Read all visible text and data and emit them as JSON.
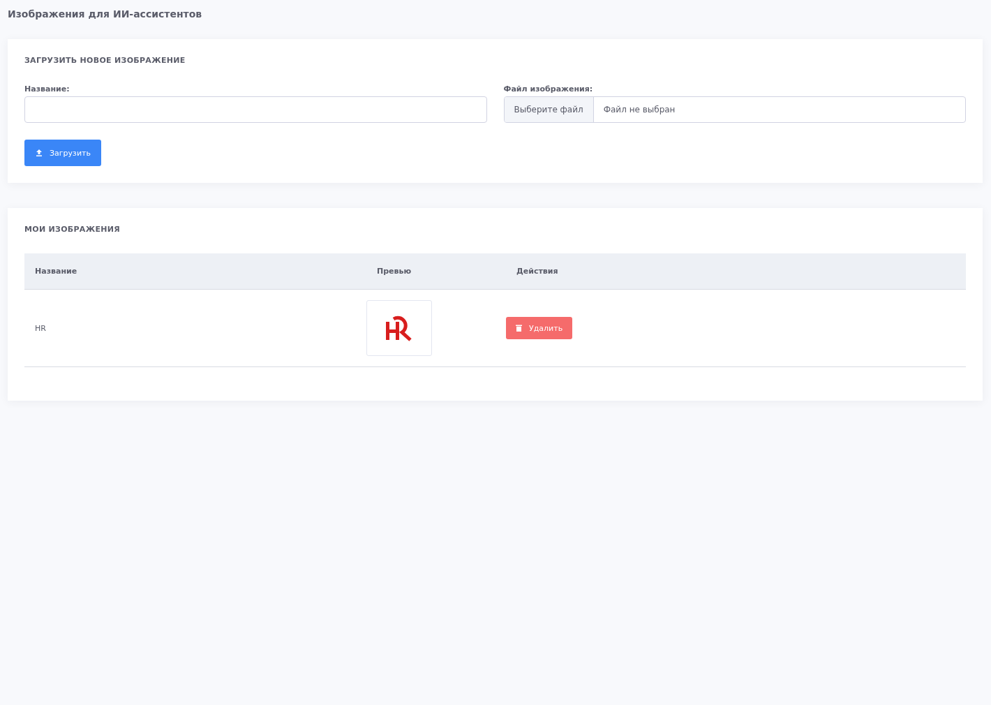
{
  "page_title": "Изображения для ИИ-ассистентов",
  "upload": {
    "title": "ЗАГРУЗИТЬ НОВОЕ ИЗОБРАЖЕНИЕ",
    "name_label": "Название:",
    "file_label": "Файл изображения:",
    "file_button": "Выберите файл",
    "file_status": "Файл не выбран",
    "submit": "Загрузить"
  },
  "images": {
    "title": "МОИ ИЗОБРАЖЕНИЯ",
    "columns": [
      "Название",
      "Превью",
      "Действия"
    ],
    "rows": [
      {
        "name": "HR",
        "delete": "Удалить"
      }
    ]
  }
}
